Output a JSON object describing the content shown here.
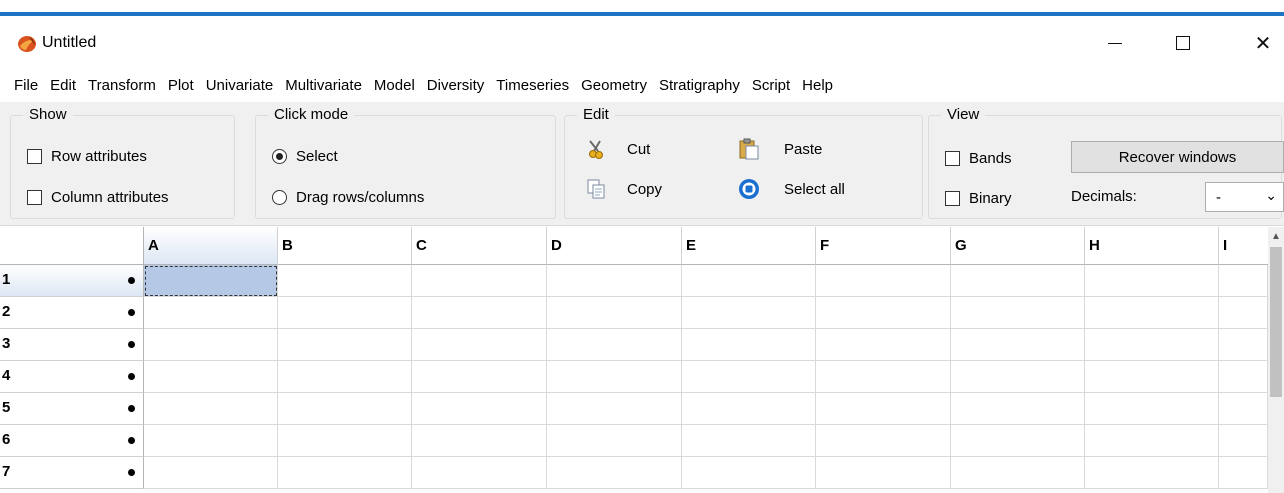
{
  "window": {
    "title": "Untitled",
    "minimize_icon": "minimize-icon",
    "maximize_icon": "maximize-icon",
    "close_glyph": "✕"
  },
  "menu": [
    "File",
    "Edit",
    "Transform",
    "Plot",
    "Univariate",
    "Multivariate",
    "Model",
    "Diversity",
    "Timeseries",
    "Geometry",
    "Stratigraphy",
    "Script",
    "Help"
  ],
  "show_group": {
    "legend": "Show",
    "row_attributes": "Row attributes",
    "column_attributes": "Column attributes"
  },
  "click_mode_group": {
    "legend": "Click mode",
    "select": "Select",
    "drag": "Drag rows/columns",
    "selected": "select"
  },
  "edit_group": {
    "legend": "Edit",
    "cut": "Cut",
    "copy": "Copy",
    "paste": "Paste",
    "select_all": "Select all"
  },
  "view_group": {
    "legend": "View",
    "bands": "Bands",
    "binary": "Binary",
    "recover_windows": "Recover windows",
    "decimals_label": "Decimals:",
    "decimals_value": "-"
  },
  "grid": {
    "columns": [
      "A",
      "B",
      "C",
      "D",
      "E",
      "F",
      "G",
      "H",
      "I"
    ],
    "rows": [
      "1",
      "2",
      "3",
      "4",
      "5",
      "6",
      "7"
    ],
    "selected_cell": "A1"
  },
  "colors": {
    "accent_stripe": "#1f73c3",
    "selected_cell": "#b5c9e6"
  }
}
